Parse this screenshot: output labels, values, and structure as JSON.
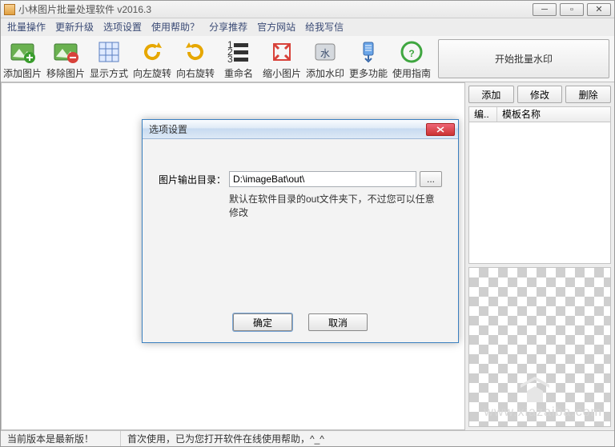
{
  "title": "小林图片批量处理软件  v2016.3",
  "menus": [
    "批量操作",
    "更新升级",
    "选项设置",
    "使用帮助？",
    "分享推荐",
    "官方网站",
    "给我写信"
  ],
  "toolbar": [
    {
      "label": "添加图片",
      "icon": "add-image"
    },
    {
      "label": "移除图片",
      "icon": "remove-image"
    },
    {
      "label": "显示方式",
      "icon": "view-mode"
    },
    {
      "label": "向左旋转",
      "icon": "rotate-left"
    },
    {
      "label": "向右旋转",
      "icon": "rotate-right"
    },
    {
      "label": "重命名",
      "icon": "rename"
    },
    {
      "label": "缩小图片",
      "icon": "resize"
    },
    {
      "label": "添加水印",
      "icon": "watermark"
    },
    {
      "label": "更多功能",
      "icon": "more"
    },
    {
      "label": "使用指南",
      "icon": "help"
    }
  ],
  "big_button": "开始批量水印",
  "right": {
    "add": "添加",
    "edit": "修改",
    "del": "删除",
    "col1": "编..",
    "col2": "模板名称"
  },
  "status": {
    "left": "当前版本是最新版！",
    "right": "首次使用，已为您打开软件在线使用帮助，^_^"
  },
  "watermark": "www.xiazaiba.com",
  "dialog": {
    "title": "选项设置",
    "field_label": "图片输出目录：",
    "field_value": "D:\\imageBat\\out\\",
    "browse": "...",
    "hint": "默认在软件目录的out文件夹下，不过您可以任意修改",
    "ok": "确定",
    "cancel": "取消"
  }
}
